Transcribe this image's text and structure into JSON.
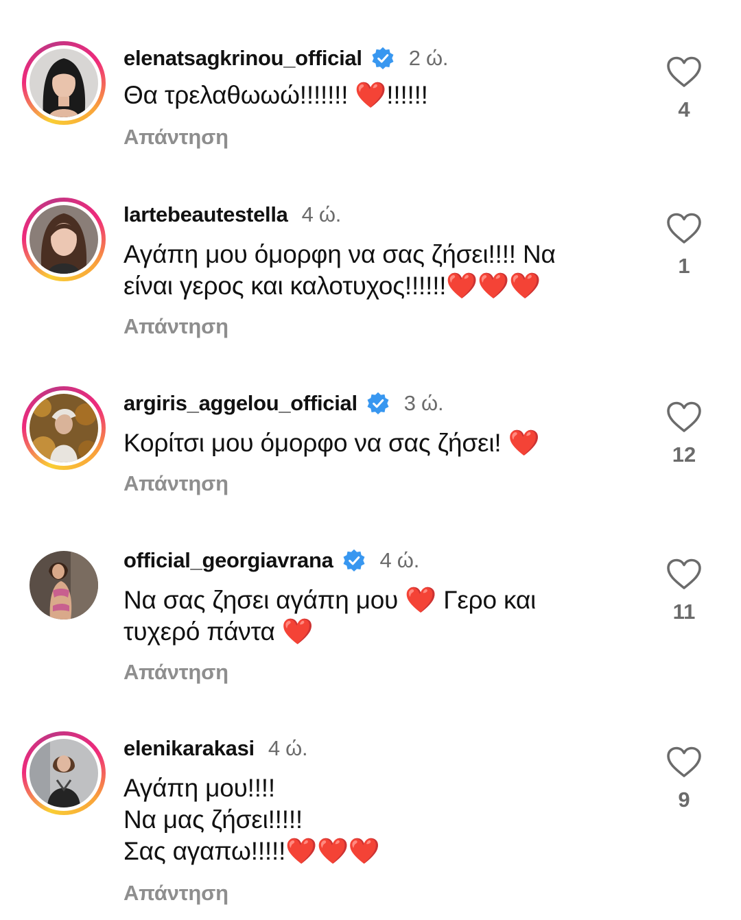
{
  "comments": [
    {
      "username": "elenatsagkrinou_official",
      "verified": true,
      "time": "2 ώ.",
      "lines": [
        "Θα τρελαθωωώ!!!!!!! ❤️!!!!!!"
      ],
      "reply_label": "Απάντηση",
      "likes": "4",
      "has_story_ring": true
    },
    {
      "username": "lartebeautestella",
      "verified": false,
      "time": "4 ώ.",
      "lines": [
        "Αγάπη μου όμορφη να σας ζήσει!!!! Να",
        "είναι γερος και καλοτυχος!!!!!!❤️❤️❤️"
      ],
      "reply_label": "Απάντηση",
      "likes": "1",
      "has_story_ring": true
    },
    {
      "username": "argiris_aggelou_official",
      "verified": true,
      "time": "3 ώ.",
      "lines": [
        "Κορίτσι μου όμορφο να σας ζήσει! ❤️"
      ],
      "reply_label": "Απάντηση",
      "likes": "12",
      "has_story_ring": true
    },
    {
      "username": "official_georgiavrana",
      "verified": true,
      "time": "4 ώ.",
      "lines": [
        "Να σας ζησει αγάπη μου ❤️ Γερο και",
        "τυχερό πάντα ❤️"
      ],
      "reply_label": "Απάντηση",
      "likes": "11",
      "has_story_ring": false
    },
    {
      "username": "elenikarakasi",
      "verified": false,
      "time": "4 ώ.",
      "lines": [
        "Αγάπη μου!!!!",
        "Να μας ζήσει!!!!!",
        "Σας αγαπω!!!!!❤️❤️❤️"
      ],
      "reply_label": "Απάντηση",
      "likes": "9",
      "has_story_ring": true
    }
  ],
  "colors": {
    "verified_badge": "#3897f0",
    "secondary_text": "#6b6b6b",
    "reply_text": "#8e8e8e",
    "emoji_heart": "#e0202a"
  },
  "icons": {
    "like": "heart-outline-icon",
    "verified": "verified-badge-icon"
  }
}
